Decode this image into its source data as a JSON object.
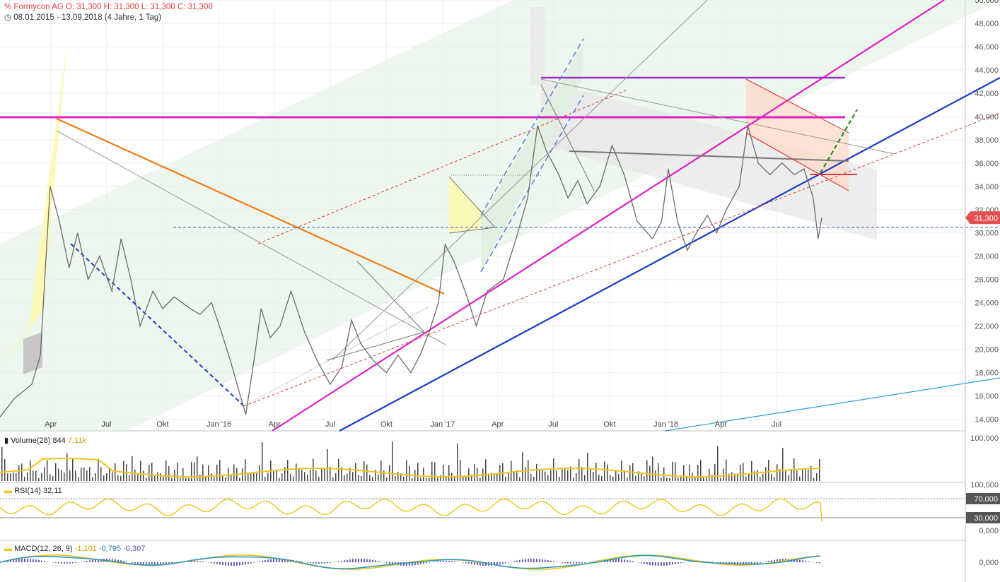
{
  "header": {
    "symbol": "Formycon AG",
    "ohlc": "O: 31,300  H: 31,300  L: 31,300  C: 31,300",
    "range": "08.01.2015 - 13.09.2018",
    "period": "(4 Jahre, 1 Tag)"
  },
  "chart_data": {
    "type": "line",
    "title": "Formycon AG",
    "x_range": [
      "2015-01-08",
      "2018-09-13"
    ],
    "ylim": [
      13,
      50
    ],
    "y_ticks": [
      "14,000",
      "16,000",
      "18,000",
      "20,000",
      "22,000",
      "24,000",
      "26,000",
      "28,000",
      "30,000",
      "32,000",
      "34,000",
      "36,000",
      "38,000",
      "40,000",
      "42,000",
      "44,000",
      "46,000",
      "48,000",
      "50,000"
    ],
    "x_ticks": [
      "Apr",
      "Jul",
      "Okt",
      "Jan '16",
      "Apr",
      "Jul",
      "Okt",
      "Jan '17",
      "Apr",
      "Jul",
      "Okt",
      "Jan '18",
      "Apr",
      "Jul"
    ],
    "last_price_label": "31,300",
    "series": [
      {
        "name": "Formycon AG",
        "points": [
          [
            "2015-01-08",
            14.2
          ],
          [
            "2015-02-01",
            15.8
          ],
          [
            "2015-03-01",
            17.0
          ],
          [
            "2015-03-15",
            19.5
          ],
          [
            "2015-03-31",
            34.0
          ],
          [
            "2015-04-15",
            31.0
          ],
          [
            "2015-05-01",
            27.0
          ],
          [
            "2015-05-15",
            30.0
          ],
          [
            "2015-06-01",
            26.0
          ],
          [
            "2015-06-20",
            28.0
          ],
          [
            "2015-07-10",
            25.0
          ],
          [
            "2015-07-25",
            29.5
          ],
          [
            "2015-08-10",
            26.0
          ],
          [
            "2015-08-25",
            22.0
          ],
          [
            "2015-09-15",
            25.0
          ],
          [
            "2015-10-01",
            23.5
          ],
          [
            "2015-10-20",
            24.5
          ],
          [
            "2015-11-15",
            23.5
          ],
          [
            "2015-12-01",
            23.0
          ],
          [
            "2015-12-20",
            24.0
          ],
          [
            "2016-01-05",
            21.5
          ],
          [
            "2016-01-20",
            19.0
          ],
          [
            "2016-02-05",
            16.0
          ],
          [
            "2016-02-14",
            14.4
          ],
          [
            "2016-03-01",
            20.0
          ],
          [
            "2016-03-10",
            23.5
          ],
          [
            "2016-03-25",
            21.0
          ],
          [
            "2016-04-10",
            22.0
          ],
          [
            "2016-04-28",
            25.0
          ],
          [
            "2016-05-20",
            21.5
          ],
          [
            "2016-06-10",
            19.0
          ],
          [
            "2016-07-01",
            17.0
          ],
          [
            "2016-07-20",
            18.5
          ],
          [
            "2016-08-05",
            22.5
          ],
          [
            "2016-08-20",
            20.5
          ],
          [
            "2016-09-10",
            19.0
          ],
          [
            "2016-10-01",
            18.0
          ],
          [
            "2016-10-20",
            19.5
          ],
          [
            "2016-11-10",
            18.0
          ],
          [
            "2016-11-25",
            19.5
          ],
          [
            "2016-12-10",
            21.5
          ],
          [
            "2016-12-25",
            24.0
          ],
          [
            "2017-01-05",
            29.0
          ],
          [
            "2017-01-20",
            27.5
          ],
          [
            "2017-02-10",
            24.5
          ],
          [
            "2017-02-25",
            22.0
          ],
          [
            "2017-03-15",
            25.0
          ],
          [
            "2017-04-10",
            26.0
          ],
          [
            "2017-05-01",
            29.5
          ],
          [
            "2017-05-20",
            33.0
          ],
          [
            "2017-06-05",
            39.2
          ],
          [
            "2017-06-20",
            37.0
          ],
          [
            "2017-07-10",
            35.0
          ],
          [
            "2017-07-25",
            33.0
          ],
          [
            "2017-08-10",
            34.5
          ],
          [
            "2017-08-25",
            32.5
          ],
          [
            "2017-09-15",
            34.0
          ],
          [
            "2017-10-05",
            37.5
          ],
          [
            "2017-10-25",
            35.0
          ],
          [
            "2017-11-15",
            31.0
          ],
          [
            "2017-12-10",
            29.5
          ],
          [
            "2017-12-25",
            31.0
          ],
          [
            "2018-01-05",
            35.5
          ],
          [
            "2018-01-20",
            31.0
          ],
          [
            "2018-02-05",
            28.5
          ],
          [
            "2018-02-20",
            30.0
          ],
          [
            "2018-03-10",
            31.5
          ],
          [
            "2018-03-25",
            30.0
          ],
          [
            "2018-04-10",
            32.0
          ],
          [
            "2018-05-01",
            34.0
          ],
          [
            "2018-05-15",
            39.2
          ],
          [
            "2018-06-01",
            36.0
          ],
          [
            "2018-06-20",
            35.0
          ],
          [
            "2018-07-10",
            36.0
          ],
          [
            "2018-07-30",
            35.0
          ],
          [
            "2018-08-15",
            35.5
          ],
          [
            "2018-08-30",
            33.0
          ],
          [
            "2018-09-07",
            29.5
          ],
          [
            "2018-09-13",
            31.3
          ]
        ]
      }
    ],
    "indicators": [
      {
        "name": "Volume(28)",
        "values": [
          "844",
          "7,11k"
        ],
        "y_tick": "100,000"
      },
      {
        "name": "RSI(14)",
        "values": [
          "32,11"
        ],
        "levels": [
          "70,000",
          "30,000"
        ],
        "y_tick": "0,000",
        "top_tick": "100,000"
      },
      {
        "name": "MACD(12, 26, 9)",
        "values": [
          "-1,101",
          "-0,795",
          "-0,307"
        ],
        "y_tick": "0,000"
      }
    ]
  },
  "colors": {
    "price": "#6a6a6a",
    "magenta_line": "#e01fc4",
    "blue_line": "#1a3ac8",
    "orange_line": "#f07a14",
    "red_line": "#e03b3b",
    "rsi": "#f0c419",
    "macd_line": "#f0c419",
    "macd_signal": "#2b9ab9",
    "macd_hist": "#5b4bb0",
    "label_badge": "#555555",
    "price_badge": "#e35050"
  }
}
